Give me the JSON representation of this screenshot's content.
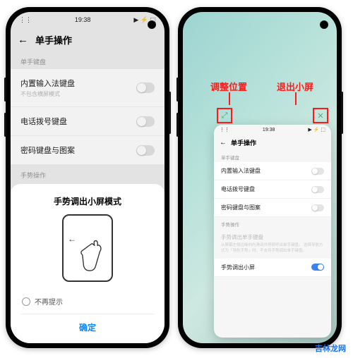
{
  "status": {
    "time": "19:38",
    "signal_icons": "⋮⋮",
    "net_icons": "▶ ⚡ ⬚"
  },
  "page_title": "单手操作",
  "section_keyboard": "单手键盘",
  "rows": {
    "ime": {
      "label": "内置输入法键盘",
      "desc": "不包含横屏模式"
    },
    "dial": {
      "label": "电话拨号键盘"
    },
    "pwd": {
      "label": "密码键盘与图案"
    }
  },
  "section_gesture": "手势操作",
  "gesture_block": {
    "title": "手势调出单手键盘",
    "desc": "从屏幕左侧边缘向内滑动并停顿呼出单手键盘。\n选择导航方式为「导航手势」时，不支持手势调出单手键盘。"
  },
  "sheet": {
    "title": "手势调出小屏模式",
    "no_remind": "不再提示",
    "confirm": "确定"
  },
  "right": {
    "label_move": "调整位置",
    "label_exit": "退出小屏",
    "resize_icon": "⤢",
    "close_icon": "✕",
    "mini_time": "19:38",
    "mini_title": "单手操作",
    "gesture_row": "手势调出小屏"
  },
  "watermark": "吉林龙网"
}
